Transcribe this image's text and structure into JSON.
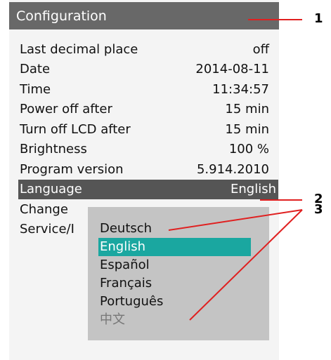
{
  "window": {
    "title": "Configuration"
  },
  "settings": [
    {
      "label": "Last decimal place",
      "value": "off"
    },
    {
      "label": "Date",
      "value": "2014-08-11"
    },
    {
      "label": "Time",
      "value": "11:34:57"
    },
    {
      "label": "Power off after",
      "value": "15 min"
    },
    {
      "label": "Turn off LCD after",
      "value": "15 min"
    },
    {
      "label": "Brightness",
      "value": "100 %"
    },
    {
      "label": "Program version",
      "value": "5.914.2010"
    },
    {
      "label": "Language",
      "value": "English",
      "selected": true
    },
    {
      "label": "Change",
      "value": ""
    },
    {
      "label": "Service/I",
      "value": ""
    }
  ],
  "language_dropdown": {
    "options": [
      "Deutsch",
      "English",
      "Español",
      "Français",
      "Português",
      "中文"
    ],
    "highlighted": "English"
  },
  "callouts": [
    "1",
    "2",
    "3"
  ],
  "colors": {
    "titlebar": "#686868",
    "selected_row": "#555555",
    "dropdown_bg": "#c4c4c4",
    "highlight": "#1aa7a0",
    "callout_line": "#e02020"
  }
}
